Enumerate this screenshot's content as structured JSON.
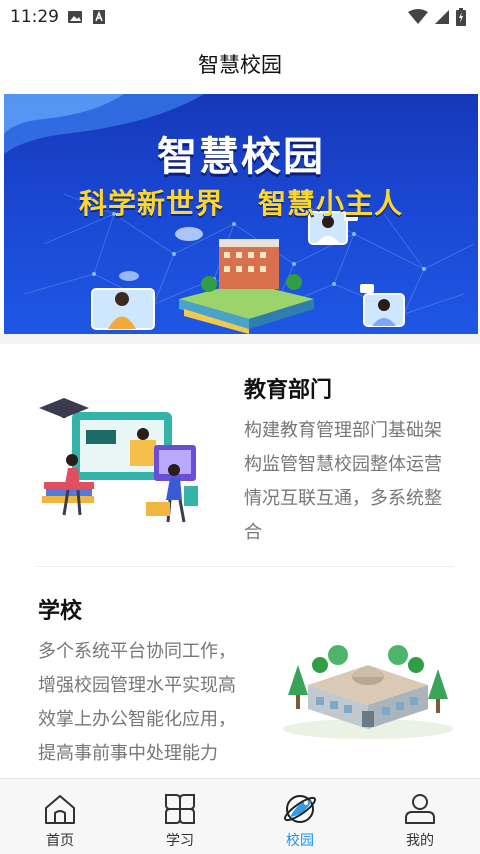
{
  "status": {
    "time": "11:29",
    "icons": [
      "image-icon",
      "text-a-icon",
      "wifi-icon",
      "signal-icon",
      "battery-icon"
    ]
  },
  "header": {
    "title": "智慧校园"
  },
  "banner": {
    "title": "智慧校园",
    "slogan_left": "科学新世界",
    "slogan_right": "智慧小主人"
  },
  "cards": [
    {
      "title": "教育部门",
      "description": [
        "构建教育管理部门基础架",
        "构监管智慧校园整体运营",
        "情况互联互通，多系统整",
        "合"
      ]
    },
    {
      "title": "学校",
      "description": [
        "多个系统平台协同工作，",
        "增强校园管理水平实现高",
        "效掌上办公智能化应用，",
        "提高事前事中处理能力"
      ]
    }
  ],
  "tabbar": {
    "active": "校园",
    "items": [
      {
        "label": "首页",
        "icon": "home-icon"
      },
      {
        "label": "学习",
        "icon": "grid-icon"
      },
      {
        "label": "校园",
        "icon": "planet-icon"
      },
      {
        "label": "我的",
        "icon": "user-icon"
      }
    ]
  },
  "colors": {
    "accent": "#1f8ff2",
    "banner": "#1a47d2",
    "slogan": "#ffd62a"
  }
}
